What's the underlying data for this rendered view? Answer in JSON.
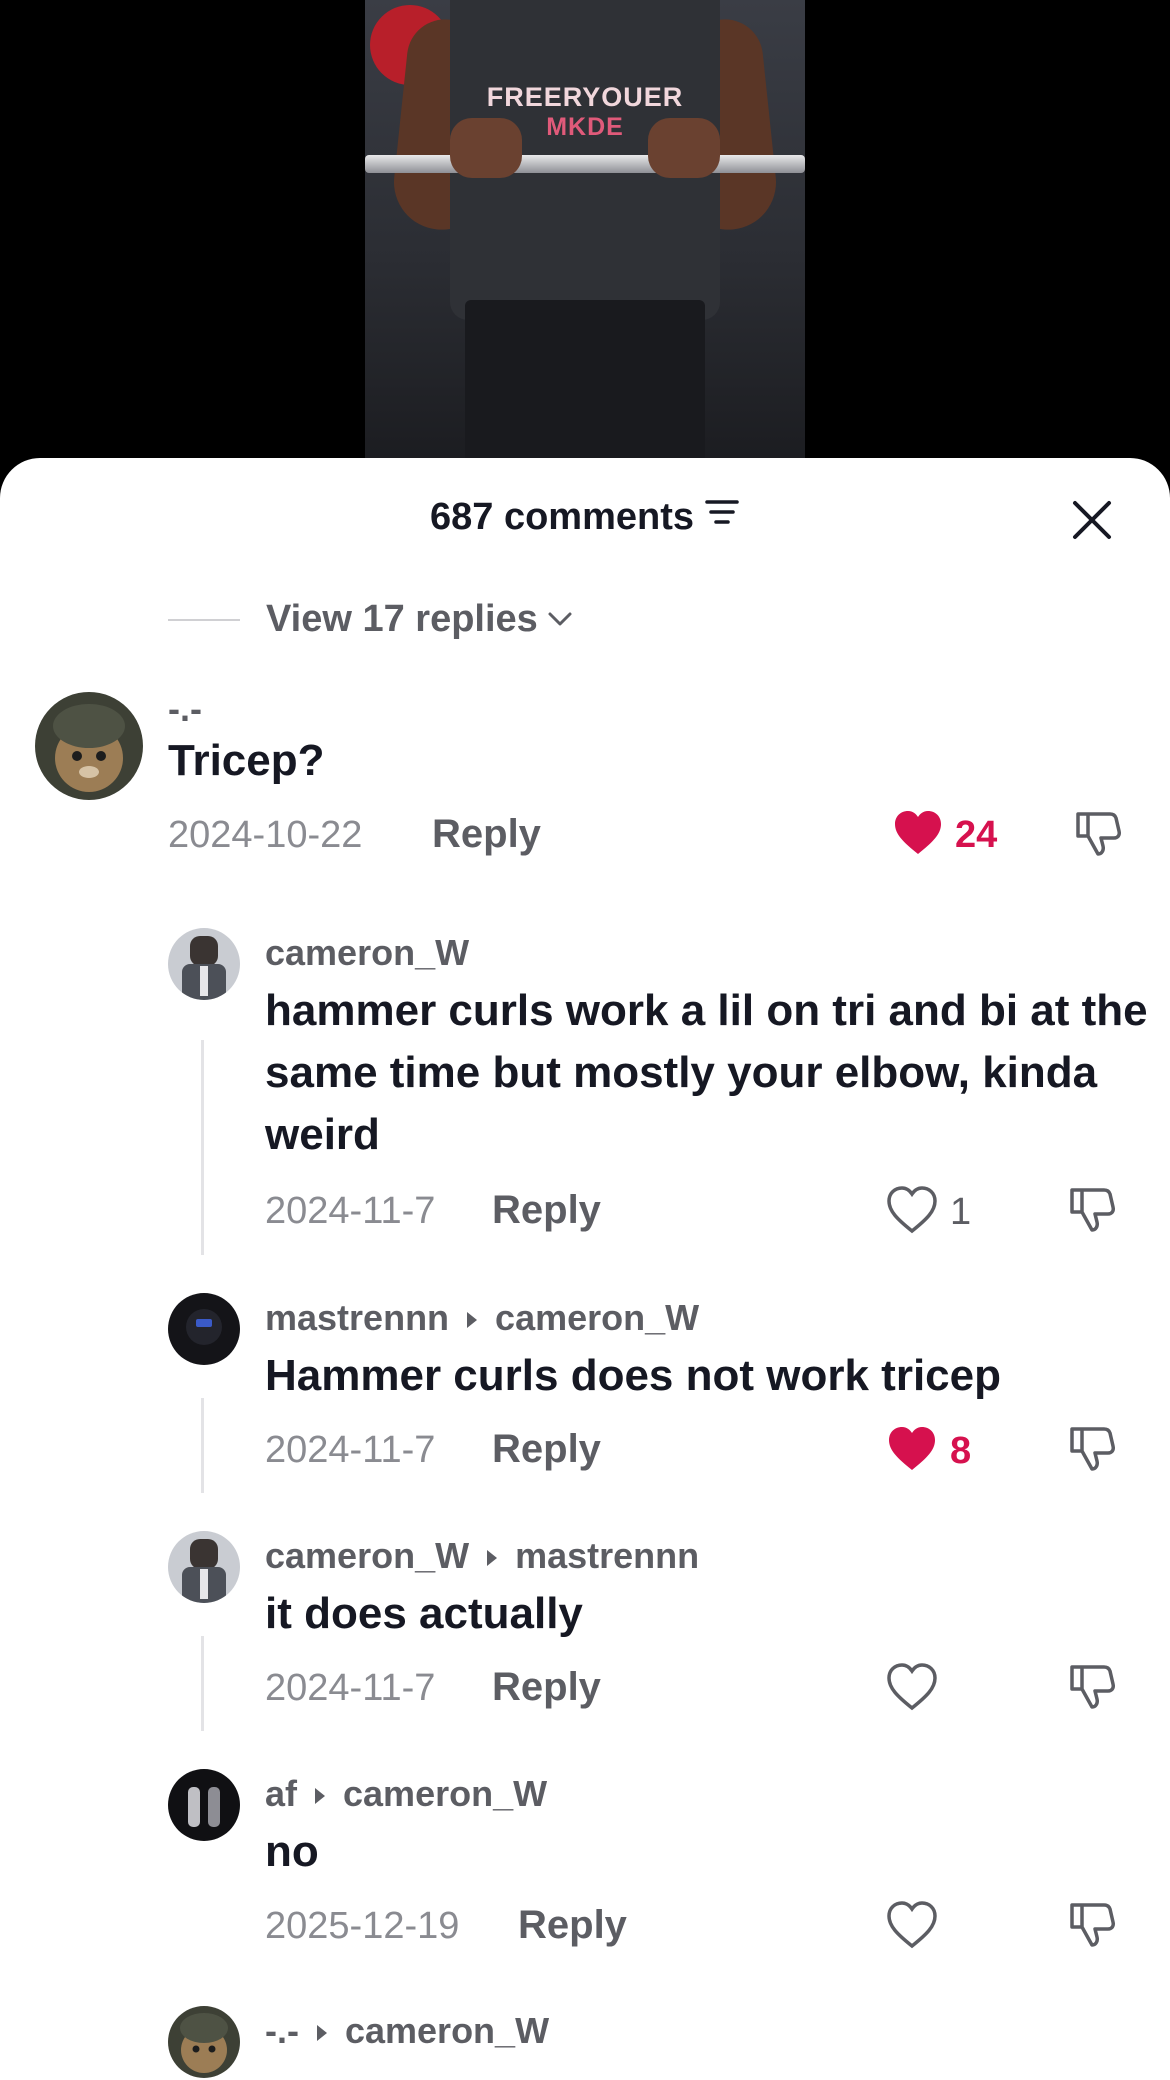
{
  "video": {
    "shirt_text_line1": "FREERYOUER",
    "shirt_text_line2": "MKDE"
  },
  "sheet": {
    "comment_count": "687 comments",
    "close_icon": "close-icon",
    "sort_icon": "sort-icon"
  },
  "view_replies": {
    "label": "View 17 replies"
  },
  "comments": [
    {
      "username": "-.-",
      "text": "Tricep?",
      "date": "2024-10-22",
      "reply": "Reply",
      "likes": "24",
      "liked": true
    },
    {
      "username": "cameron_W",
      "text": "hammer curls work a lil on tri and bi at the same time but mostly your elbow, kinda weird",
      "date": "2024-11-7",
      "reply": "Reply",
      "likes": "1",
      "liked": false
    },
    {
      "username": "mastrennn",
      "reply_to": "cameron_W",
      "text": "Hammer curls does not work tricep",
      "date": "2024-11-7",
      "reply": "Reply",
      "likes": "8",
      "liked": true
    },
    {
      "username": "cameron_W",
      "reply_to": "mastrennn",
      "text": "it does actually",
      "date": "2024-11-7",
      "reply": "Reply",
      "likes": "",
      "liked": false
    },
    {
      "username": "af",
      "reply_to": "cameron_W",
      "text": "no",
      "date": "2025-12-19",
      "reply": "Reply",
      "likes": "",
      "liked": false
    },
    {
      "username": "-.-",
      "reply_to": "cameron_W"
    }
  ],
  "colors": {
    "like_red": "#d6114e",
    "text_primary": "#161823",
    "text_secondary": "#5c5d63",
    "text_meta": "#8a8b91"
  }
}
